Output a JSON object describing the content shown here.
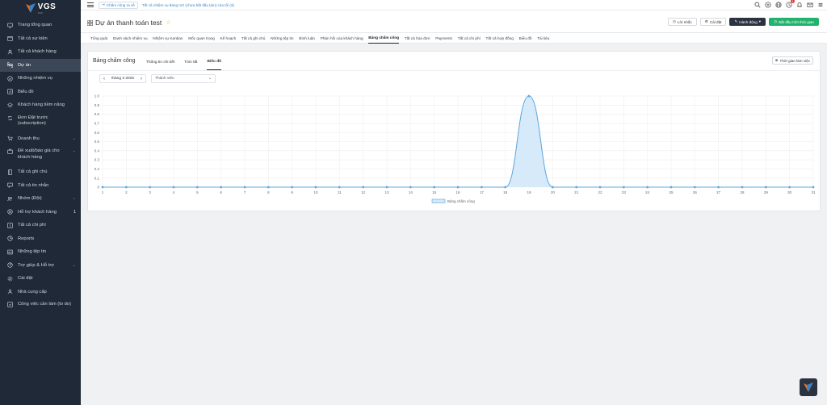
{
  "app": {
    "logo_text": "VGS",
    "logo_sub": "JSC"
  },
  "sidebar": {
    "items": [
      {
        "label": "Trang tổng quan",
        "icon": "monitor-icon"
      },
      {
        "label": "Tất cả sự kiện",
        "icon": "calendar-icon"
      },
      {
        "label": "Tất cả khách hàng",
        "icon": "user-icon"
      },
      {
        "label": "Dự án",
        "icon": "command-icon",
        "active": true
      },
      {
        "label": "Những nhiệm vụ",
        "icon": "check-circle-icon"
      },
      {
        "label": "Biểu đồ",
        "icon": "chart-icon"
      },
      {
        "label": "Khách hàng tiềm năng",
        "icon": "layers-icon"
      },
      {
        "label": "Đơn Đặt trước (subscription)",
        "icon": "repeat-icon",
        "tall": true
      },
      {
        "label": "Doanh thu",
        "icon": "cart-icon",
        "chevron": "⌄"
      },
      {
        "label": "Đề xuất/báo giá cho khách hàng",
        "icon": "briefcase-icon",
        "tall": true,
        "chevron": "⌄"
      },
      {
        "label": "Tất cả ghi chú",
        "icon": "book-icon"
      },
      {
        "label": "Tất cả tin nhắn",
        "icon": "message-icon"
      },
      {
        "label": "Nhóm (Đội)",
        "icon": "users-icon",
        "chevron": "⌄"
      },
      {
        "label": "Hỗ trợ khách hàng",
        "icon": "life-buoy-icon",
        "count": "1"
      },
      {
        "label": "Tất cả chi phí",
        "icon": "dollar-icon"
      },
      {
        "label": "Reports",
        "icon": "pie-icon"
      },
      {
        "label": "Những tệp tin",
        "icon": "image-icon"
      },
      {
        "label": "Trợ giúp & Hỗ trợ",
        "icon": "help-icon",
        "chevron": "⌄"
      },
      {
        "label": "Cài đặt",
        "icon": "settings-icon"
      },
      {
        "label": "Nhà cung cấp",
        "icon": "users-alt-icon"
      },
      {
        "label": "Công việc cần làm (to do)",
        "icon": "check-square-icon",
        "tall": true
      }
    ]
  },
  "topbar": {
    "clock_chip": "Chấm công ra về",
    "task_link": "Tất cả nhiệm vụ đang mở (chưa bắt đầu làm) của tôi (3)",
    "notification_count": "1"
  },
  "header": {
    "title": "Dự án thanh toán test",
    "reminder_label": "Lời nhắc",
    "settings_label": "Cài đặt",
    "actions_label": "Hành động",
    "start_timer_label": "Bắt đầu tính thời gian"
  },
  "tabs": [
    "Tổng quát",
    "Danh sách nhiệm vụ",
    "Nhiệm vụ Kanban",
    "Mốc quan trọng",
    "Kế hoạch",
    "Tất cả ghi chú",
    "Những tệp tin",
    "Bình luận",
    "Phản hồi của khách hàng",
    "Bảng chấm công",
    "Tất cả hóa đơn",
    "Payments",
    "Tất cả chi phí",
    "Tất cả hợp đồng",
    "Biểu đồ",
    "Tài liệu"
  ],
  "active_tab_index": 9,
  "card": {
    "title": "Bảng chấm công",
    "subtabs": [
      "Thông tin chi tiết",
      "Tóm tắt",
      "Biểu đồ"
    ],
    "active_subtab_index": 2,
    "timelog_label": "Thời gian làm việc",
    "month_label": "tháng 3 2025",
    "member_placeholder": "Thành viên"
  },
  "colors": {
    "accent_green": "#23b26d",
    "dark": "#2c3340",
    "series_line": "#5aa7e0",
    "series_fill": "#d3e8f8"
  },
  "chart_data": {
    "type": "area",
    "x": [
      1,
      2,
      3,
      4,
      5,
      6,
      7,
      8,
      9,
      10,
      11,
      12,
      13,
      14,
      15,
      16,
      17,
      18,
      19,
      20,
      21,
      22,
      23,
      24,
      25,
      26,
      27,
      28,
      29,
      30,
      31
    ],
    "series": [
      {
        "name": "Bảng chấm công",
        "values": [
          0,
          0,
          0,
          0,
          0,
          0,
          0,
          0,
          0,
          0,
          0,
          0,
          0,
          0,
          0,
          0,
          0,
          0,
          1,
          0,
          0,
          0,
          0,
          0,
          0,
          0,
          0,
          0,
          0,
          0,
          0
        ]
      }
    ],
    "yticks": [
      "0",
      "0.1",
      "0.2",
      "0.3",
      "0.4",
      "0.5",
      "0.6",
      "0.7",
      "0.8",
      "0.9",
      "1.0"
    ],
    "ylim": [
      0,
      1
    ],
    "grid": true,
    "legend_position": "bottom"
  }
}
